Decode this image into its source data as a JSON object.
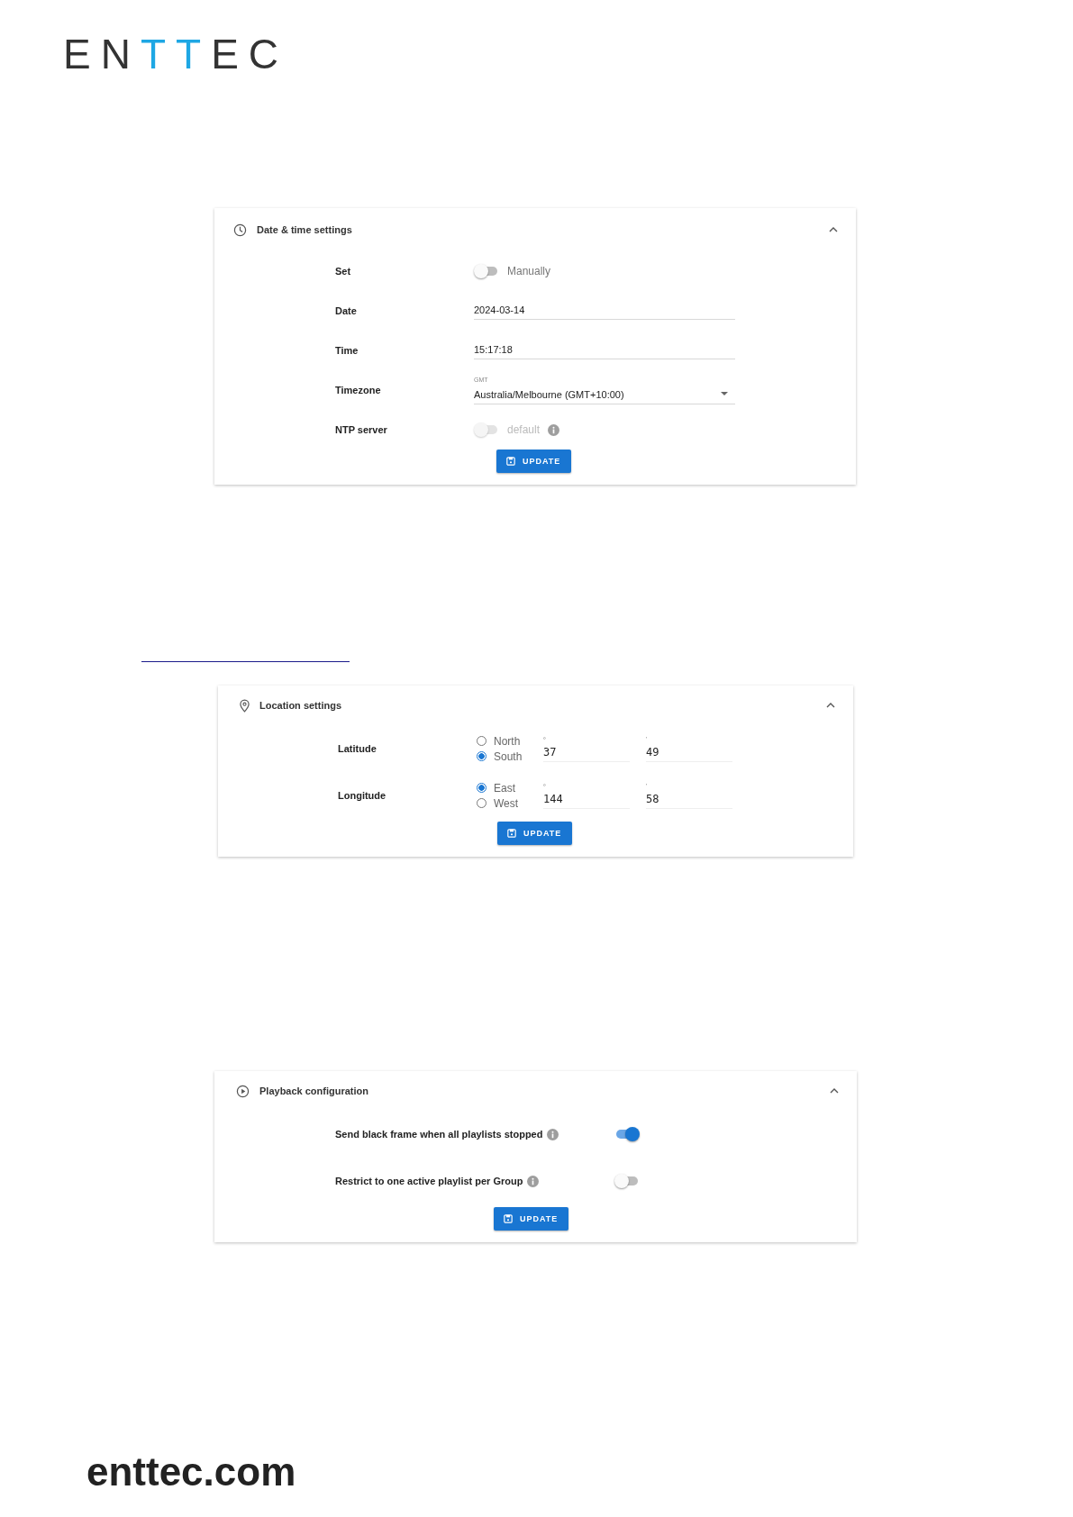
{
  "logo": {
    "letters": [
      {
        "letter": "E",
        "color": "#333333"
      },
      {
        "letter": "N",
        "color": "#333333"
      },
      {
        "letter": "T",
        "color": "#1ea7e4"
      },
      {
        "letter": "T",
        "color": "#1ea7e4"
      },
      {
        "letter": "E",
        "color": "#333333"
      },
      {
        "letter": "C",
        "color": "#333333"
      }
    ]
  },
  "date_time": {
    "title": "Date & time settings",
    "rows": [
      {
        "kind": "toggle",
        "label": "Set",
        "on": false,
        "disabled": false,
        "text": "Manually",
        "info": false
      },
      {
        "kind": "text",
        "label": "Date",
        "value": "2024-03-14"
      },
      {
        "kind": "text",
        "label": "Time",
        "value": "15:17:18"
      },
      {
        "kind": "select",
        "label": "Timezone",
        "floating_label": "GMT",
        "value": "Australia/Melbourne (GMT+10:00)"
      },
      {
        "kind": "toggle",
        "label": "NTP server",
        "on": false,
        "disabled": true,
        "text": "default",
        "info": true
      }
    ],
    "button": "UPDATE"
  },
  "location": {
    "title": "Location settings",
    "rows": [
      {
        "label": "Latitude",
        "options": [
          {
            "label": "North",
            "selected": false
          },
          {
            "label": "South",
            "selected": true
          }
        ],
        "degree_label": "º",
        "degrees": "37",
        "minute_label": "'",
        "minutes": "49"
      },
      {
        "label": "Longitude",
        "options": [
          {
            "label": "East",
            "selected": true
          },
          {
            "label": "West",
            "selected": false
          }
        ],
        "degree_label": "º",
        "degrees": "144",
        "minute_label": "'",
        "minutes": "58"
      }
    ],
    "button": "UPDATE"
  },
  "playback": {
    "title": "Playback configuration",
    "rows": [
      {
        "label": "Send black frame when all playlists stopped",
        "info": true,
        "on": true
      },
      {
        "label": "Restrict to one active playlist per Group",
        "info": true,
        "on": false
      }
    ],
    "button": "UPDATE"
  },
  "footer": {
    "site": "enttec.com"
  }
}
